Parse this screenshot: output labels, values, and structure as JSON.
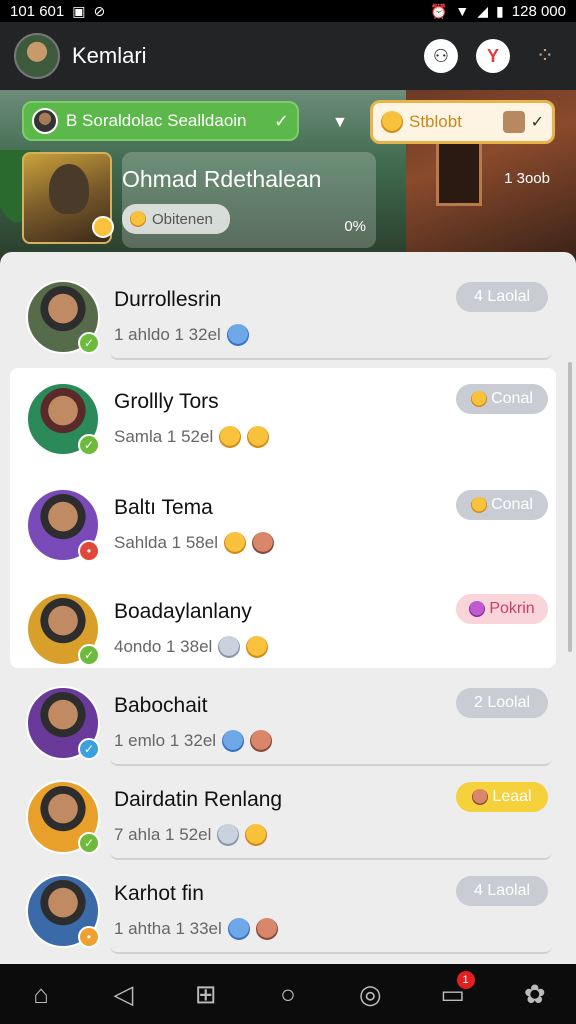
{
  "status_bar": {
    "time": "101 601",
    "battery": "128 000"
  },
  "app_bar": {
    "title": "Kemlari"
  },
  "hero": {
    "group_pill": "B Soraldolac Sealldaoin",
    "reaction_pill": "Stblobt",
    "profile_name": "Ohmad Rdethalean",
    "status_label": "Obitenen",
    "progress_label": "0%",
    "right_label": "1 3oob"
  },
  "contacts": [
    {
      "name": "Durrollesrin",
      "sub": "1 ahldo 1 32el",
      "tag": "4 Laolal",
      "tag_style": "grey",
      "status": "green"
    },
    {
      "name": "Grollly Tors",
      "sub": "Samla 1 52el",
      "tag": "Conal",
      "tag_style": "grey",
      "status": "green"
    },
    {
      "name": "Baltı Tema",
      "sub": "Sahlda 1 58el",
      "tag": "Conal",
      "tag_style": "grey",
      "status": "red"
    },
    {
      "name": "Boadaylanlany",
      "sub": "4ondo 1 38el",
      "tag": "Pokrin",
      "tag_style": "pink",
      "status": "green"
    },
    {
      "name": "Babochait",
      "sub": "1 emlo 1 32el",
      "tag": "2 Loolal",
      "tag_style": "grey",
      "status": "blue"
    },
    {
      "name": "Dairdatin Renlang",
      "sub": "7 ahla 1 52el",
      "tag": "Leaal",
      "tag_style": "yellow",
      "status": "green"
    },
    {
      "name": "Karhot fin",
      "sub": "1 ahtha 1 33el",
      "tag": "4 Laolal",
      "tag_style": "grey",
      "status": "orange"
    }
  ],
  "nav": {
    "badge": "1"
  },
  "colors": {
    "accent_green": "#5cb84a",
    "accent_yellow": "#e8b44a",
    "sheet_bg": "#ededed"
  }
}
